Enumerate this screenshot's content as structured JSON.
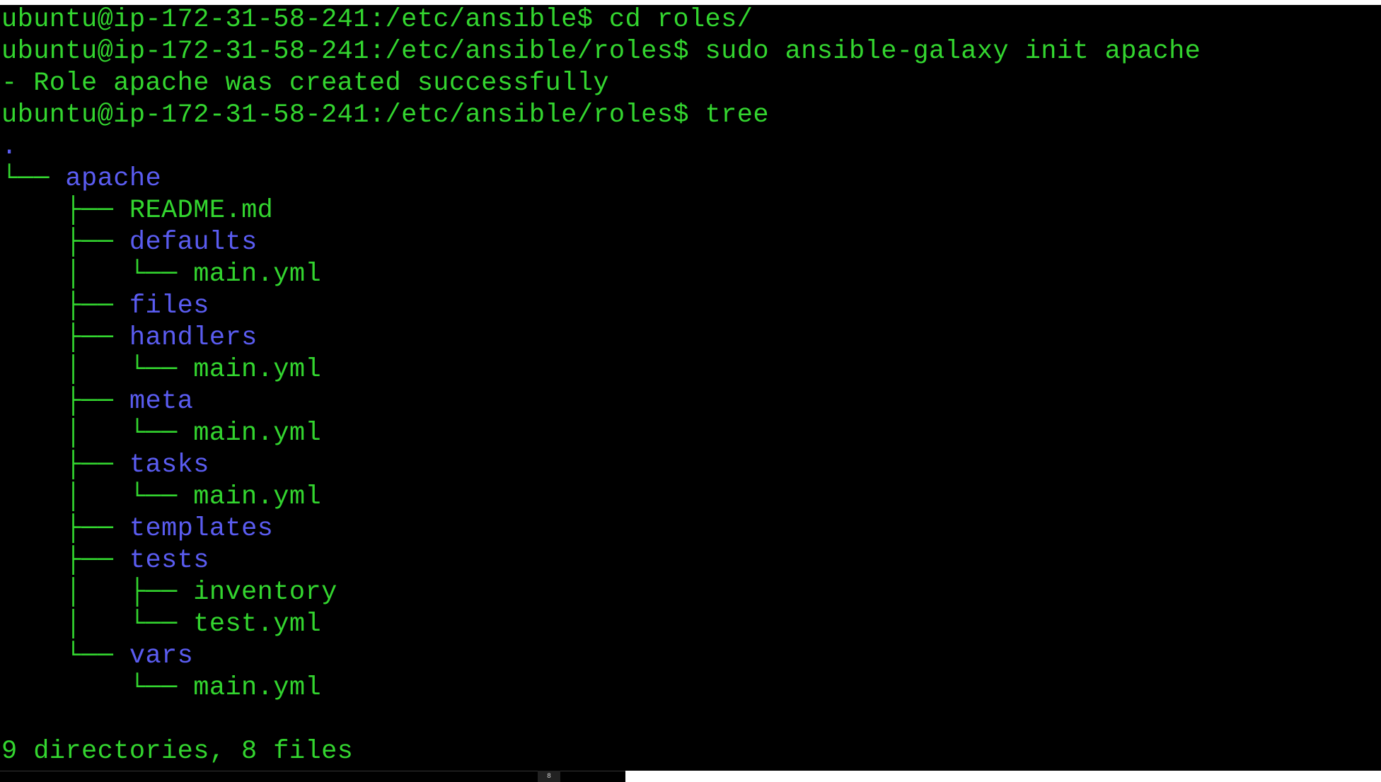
{
  "terminal": {
    "lines": [
      {
        "parts": [
          {
            "text": "ubuntu@ip-172-31-58-241:/etc/ansible$ cd roles/",
            "color": "green"
          }
        ]
      },
      {
        "parts": [
          {
            "text": "ubuntu@ip-172-31-58-241:/etc/ansible/roles$ sudo ansible-galaxy init apache",
            "color": "green"
          }
        ]
      },
      {
        "parts": [
          {
            "text": "- Role apache was created successfully",
            "color": "green"
          }
        ]
      },
      {
        "parts": [
          {
            "text": "ubuntu@ip-172-31-58-241:/etc/ansible/roles$ tree",
            "color": "green"
          }
        ]
      },
      {
        "parts": [
          {
            "text": ".",
            "color": "blue"
          }
        ]
      },
      {
        "parts": [
          {
            "text": "└── ",
            "color": "green"
          },
          {
            "text": "apache",
            "color": "blue"
          }
        ]
      },
      {
        "parts": [
          {
            "text": "    ├── ",
            "color": "green"
          },
          {
            "text": "README.md",
            "color": "green"
          }
        ]
      },
      {
        "parts": [
          {
            "text": "    ├── ",
            "color": "green"
          },
          {
            "text": "defaults",
            "color": "blue"
          }
        ]
      },
      {
        "parts": [
          {
            "text": "    │   └── ",
            "color": "green"
          },
          {
            "text": "main.yml",
            "color": "green"
          }
        ]
      },
      {
        "parts": [
          {
            "text": "    ├── ",
            "color": "green"
          },
          {
            "text": "files",
            "color": "blue"
          }
        ]
      },
      {
        "parts": [
          {
            "text": "    ├── ",
            "color": "green"
          },
          {
            "text": "handlers",
            "color": "blue"
          }
        ]
      },
      {
        "parts": [
          {
            "text": "    │   └── ",
            "color": "green"
          },
          {
            "text": "main.yml",
            "color": "green"
          }
        ]
      },
      {
        "parts": [
          {
            "text": "    ├── ",
            "color": "green"
          },
          {
            "text": "meta",
            "color": "blue"
          }
        ]
      },
      {
        "parts": [
          {
            "text": "    │   └── ",
            "color": "green"
          },
          {
            "text": "main.yml",
            "color": "green"
          }
        ]
      },
      {
        "parts": [
          {
            "text": "    ├── ",
            "color": "green"
          },
          {
            "text": "tasks",
            "color": "blue"
          }
        ]
      },
      {
        "parts": [
          {
            "text": "    │   └── ",
            "color": "green"
          },
          {
            "text": "main.yml",
            "color": "green"
          }
        ]
      },
      {
        "parts": [
          {
            "text": "    ├── ",
            "color": "green"
          },
          {
            "text": "templates",
            "color": "blue"
          }
        ]
      },
      {
        "parts": [
          {
            "text": "    ├── ",
            "color": "green"
          },
          {
            "text": "tests",
            "color": "blue"
          }
        ]
      },
      {
        "parts": [
          {
            "text": "    │   ├── ",
            "color": "green"
          },
          {
            "text": "inventory",
            "color": "green"
          }
        ]
      },
      {
        "parts": [
          {
            "text": "    │   └── ",
            "color": "green"
          },
          {
            "text": "test.yml",
            "color": "green"
          }
        ]
      },
      {
        "parts": [
          {
            "text": "    └── ",
            "color": "green"
          },
          {
            "text": "vars",
            "color": "blue"
          }
        ]
      },
      {
        "parts": [
          {
            "text": "        └── ",
            "color": "green"
          },
          {
            "text": "main.yml",
            "color": "green"
          }
        ]
      },
      {
        "parts": [
          {
            "text": "",
            "color": "green"
          }
        ]
      },
      {
        "parts": [
          {
            "text": "9 directories, 8 files",
            "color": "green"
          }
        ]
      }
    ]
  },
  "colors": {
    "background": "#000000",
    "green": "#33d52f",
    "blue": "#5a5cf0"
  },
  "taskbar": {
    "tab_glyph": "8"
  }
}
